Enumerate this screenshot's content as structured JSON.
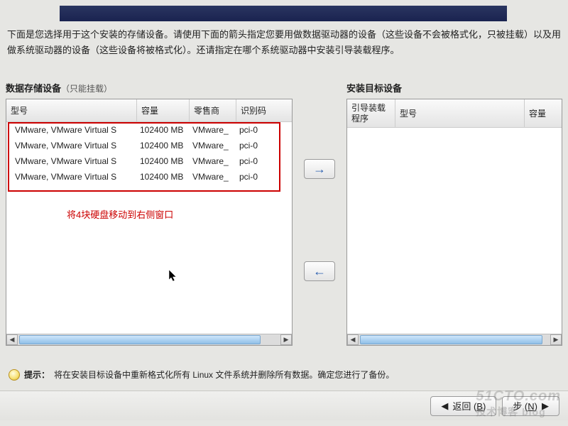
{
  "description": "下面是您选择用于这个安装的存储设备。请使用下面的箭头指定您要用做数据驱动器的设备（这些设备不会被格式化，只被挂载）以及用做系统驱动器的设备（这些设备将被格式化）。还请指定在哪个系统驱动器中安装引导装载程序。",
  "left": {
    "title": "数据存储设备",
    "subtitle": "（只能挂载）",
    "headers": {
      "model": "型号",
      "capacity": "容量",
      "vendor": "零售商",
      "id": "识别码"
    },
    "rows": [
      {
        "model": "VMware, VMware Virtual S",
        "capacity": "102400 MB",
        "vendor": "VMware_",
        "id": "pci-0"
      },
      {
        "model": "VMware, VMware Virtual S",
        "capacity": "102400 MB",
        "vendor": "VMware_",
        "id": "pci-0"
      },
      {
        "model": "VMware, VMware Virtual S",
        "capacity": "102400 MB",
        "vendor": "VMware_",
        "id": "pci-0"
      },
      {
        "model": "VMware, VMware Virtual S",
        "capacity": "102400 MB",
        "vendor": "VMware_",
        "id": "pci-0"
      }
    ],
    "annotation": "将4块硬盘移动到右侧窗口"
  },
  "right": {
    "title": "安装目标设备",
    "headers": {
      "boot": "引导装载程序",
      "model": "型号",
      "capacity": "容量"
    }
  },
  "tip": {
    "label": "提示：",
    "text": "将在安装目标设备中重新格式化所有 Linux 文件系统并删除所有数据。确定您进行了备份。"
  },
  "footer": {
    "back": "返回 (",
    "back_key": "B",
    "back_suffix": ")",
    "next": "步 (",
    "next_key": "N",
    "next_suffix": ")"
  },
  "watermark": {
    "line1": "51CTO.com",
    "line2": "技术博客 blog"
  }
}
